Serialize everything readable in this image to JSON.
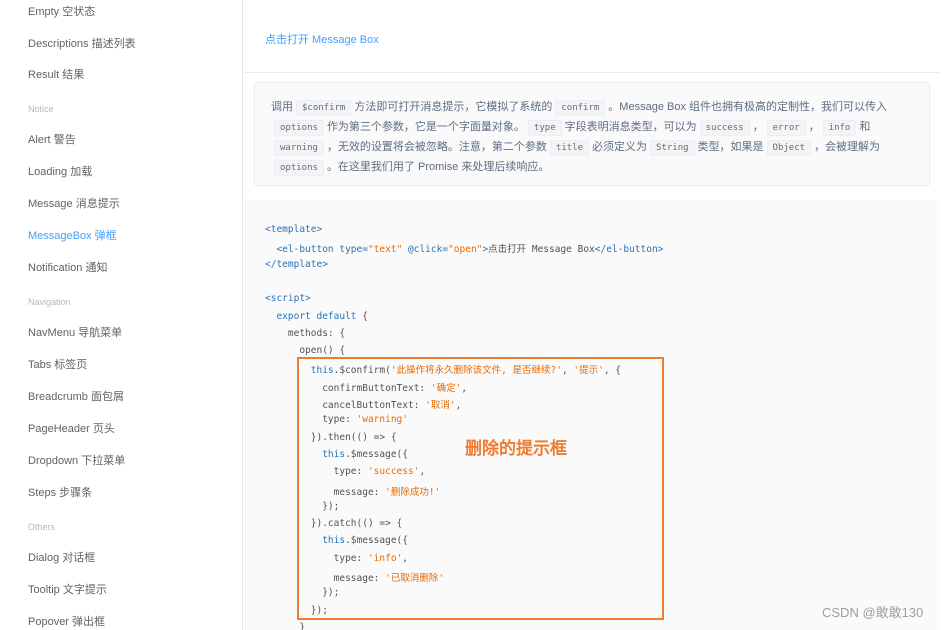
{
  "sidebar": {
    "items": [
      {
        "label": "Empty 空状态",
        "type": "item"
      },
      {
        "label": "Descriptions 描述列表",
        "type": "item"
      },
      {
        "label": "Result 结果",
        "type": "item"
      },
      {
        "label": "Notice",
        "type": "group"
      },
      {
        "label": "Alert 警告",
        "type": "item"
      },
      {
        "label": "Loading 加载",
        "type": "item"
      },
      {
        "label": "Message 消息提示",
        "type": "item"
      },
      {
        "label": "MessageBox 弹框",
        "type": "item",
        "active": true
      },
      {
        "label": "Notification 通知",
        "type": "item"
      },
      {
        "label": "Navigation",
        "type": "group"
      },
      {
        "label": "NavMenu 导航菜单",
        "type": "item"
      },
      {
        "label": "Tabs 标签页",
        "type": "item"
      },
      {
        "label": "Breadcrumb 面包屑",
        "type": "item"
      },
      {
        "label": "PageHeader 页头",
        "type": "item"
      },
      {
        "label": "Dropdown 下拉菜单",
        "type": "item"
      },
      {
        "label": "Steps 步骤条",
        "type": "item"
      },
      {
        "label": "Others",
        "type": "group"
      },
      {
        "label": "Dialog 对话框",
        "type": "item"
      },
      {
        "label": "Tooltip 文字提示",
        "type": "item"
      },
      {
        "label": "Popover 弹出框",
        "type": "item"
      }
    ]
  },
  "demo": {
    "link_label": "点击打开 Message Box"
  },
  "description": {
    "t1": "调用",
    "c1": "$confirm",
    "t2": "方法即可打开消息提示，它模拟了系统的",
    "c2": "confirm",
    "t3": "。Message Box 组件也拥有极高的定制性，我们可以传入",
    "c3": "options",
    "t4": "作为第三个参数，它是一个字面量对象。",
    "c4": "type",
    "t5": "字段表明消息类型，可以为",
    "c5": "success",
    "t6": "，",
    "c6": "error",
    "t7": "，",
    "c7": "info",
    "t8": "和",
    "c8": "warning",
    "t9": "，无效的设置将会被忽略。注意，第二个参数",
    "c9": "title",
    "t10": "必须定义为",
    "c10": "String",
    "t11": "类型，如果是",
    "c11": "Object",
    "t12": "，会被理解为",
    "c12": "options",
    "t13": "。在这里我们用了 Promise 来处理后续响应。"
  },
  "code": {
    "lines": [
      [
        {
          "t": "<template>",
          "c": "tk-tag"
        }
      ],
      [
        {
          "t": "  <el-button ",
          "c": "tk-tag"
        },
        {
          "t": "type=",
          "c": "tk-attr"
        },
        {
          "t": "\"text\"",
          "c": "tk-str"
        },
        {
          "t": " @click=",
          "c": "tk-attr"
        },
        {
          "t": "\"open\"",
          "c": "tk-str"
        },
        {
          "t": ">",
          "c": "tk-tag"
        },
        {
          "t": "点击打开 Message Box",
          "c": "tk-plain"
        },
        {
          "t": "</el-button>",
          "c": "tk-tag"
        }
      ],
      [
        {
          "t": "</template>",
          "c": "tk-tag"
        }
      ],
      [],
      [
        {
          "t": "<script>",
          "c": "tk-tag"
        }
      ],
      [
        {
          "t": "  export default ",
          "c": "tk-kw"
        },
        {
          "t": "{",
          "c": "tk-plain"
        }
      ],
      [
        {
          "t": "    methods: {",
          "c": "tk-plain"
        }
      ],
      [
        {
          "t": "      open() {",
          "c": "tk-plain"
        }
      ],
      [
        {
          "t": "        this",
          "c": "tk-kw"
        },
        {
          "t": ".$confirm(",
          "c": "tk-plain"
        },
        {
          "t": "'此操作将永久删除该文件, 是否继续?'",
          "c": "tk-strc"
        },
        {
          "t": ", ",
          "c": "tk-plain"
        },
        {
          "t": "'提示'",
          "c": "tk-strc"
        },
        {
          "t": ", {",
          "c": "tk-plain"
        }
      ],
      [
        {
          "t": "          confirmButtonText: ",
          "c": "tk-plain"
        },
        {
          "t": "'确定'",
          "c": "tk-strc"
        },
        {
          "t": ",",
          "c": "tk-plain"
        }
      ],
      [
        {
          "t": "          cancelButtonText: ",
          "c": "tk-plain"
        },
        {
          "t": "'取消'",
          "c": "tk-strc"
        },
        {
          "t": ",",
          "c": "tk-plain"
        }
      ],
      [
        {
          "t": "          type: ",
          "c": "tk-plain"
        },
        {
          "t": "'warning'",
          "c": "tk-strc"
        }
      ],
      [
        {
          "t": "        }).then(() => {",
          "c": "tk-plain"
        }
      ],
      [
        {
          "t": "          this",
          "c": "tk-kw"
        },
        {
          "t": ".$message({",
          "c": "tk-plain"
        }
      ],
      [
        {
          "t": "            type: ",
          "c": "tk-plain"
        },
        {
          "t": "'success'",
          "c": "tk-strc"
        },
        {
          "t": ",",
          "c": "tk-plain"
        }
      ],
      [
        {
          "t": "            message: ",
          "c": "tk-plain"
        },
        {
          "t": "'删除成功!'",
          "c": "tk-strc"
        }
      ],
      [
        {
          "t": "          });",
          "c": "tk-plain"
        }
      ],
      [
        {
          "t": "        }).catch(() => {",
          "c": "tk-plain"
        }
      ],
      [
        {
          "t": "          this",
          "c": "tk-kw"
        },
        {
          "t": ".$message({",
          "c": "tk-plain"
        }
      ],
      [
        {
          "t": "            type: ",
          "c": "tk-plain"
        },
        {
          "t": "'info'",
          "c": "tk-strc"
        },
        {
          "t": ",",
          "c": "tk-plain"
        }
      ],
      [
        {
          "t": "            message: ",
          "c": "tk-plain"
        },
        {
          "t": "'已取消删除'",
          "c": "tk-strc"
        }
      ],
      [
        {
          "t": "          });",
          "c": "tk-plain"
        }
      ],
      [
        {
          "t": "        });",
          "c": "tk-plain"
        }
      ],
      [
        {
          "t": "      }",
          "c": "tk-plain"
        }
      ]
    ]
  },
  "annotation": {
    "label": "删除的提示框",
    "color": "#ed7d31"
  },
  "watermark": "CSDN @敢敢130",
  "colors": {
    "accent": "#409eff",
    "highlight": "#ed7d31"
  }
}
